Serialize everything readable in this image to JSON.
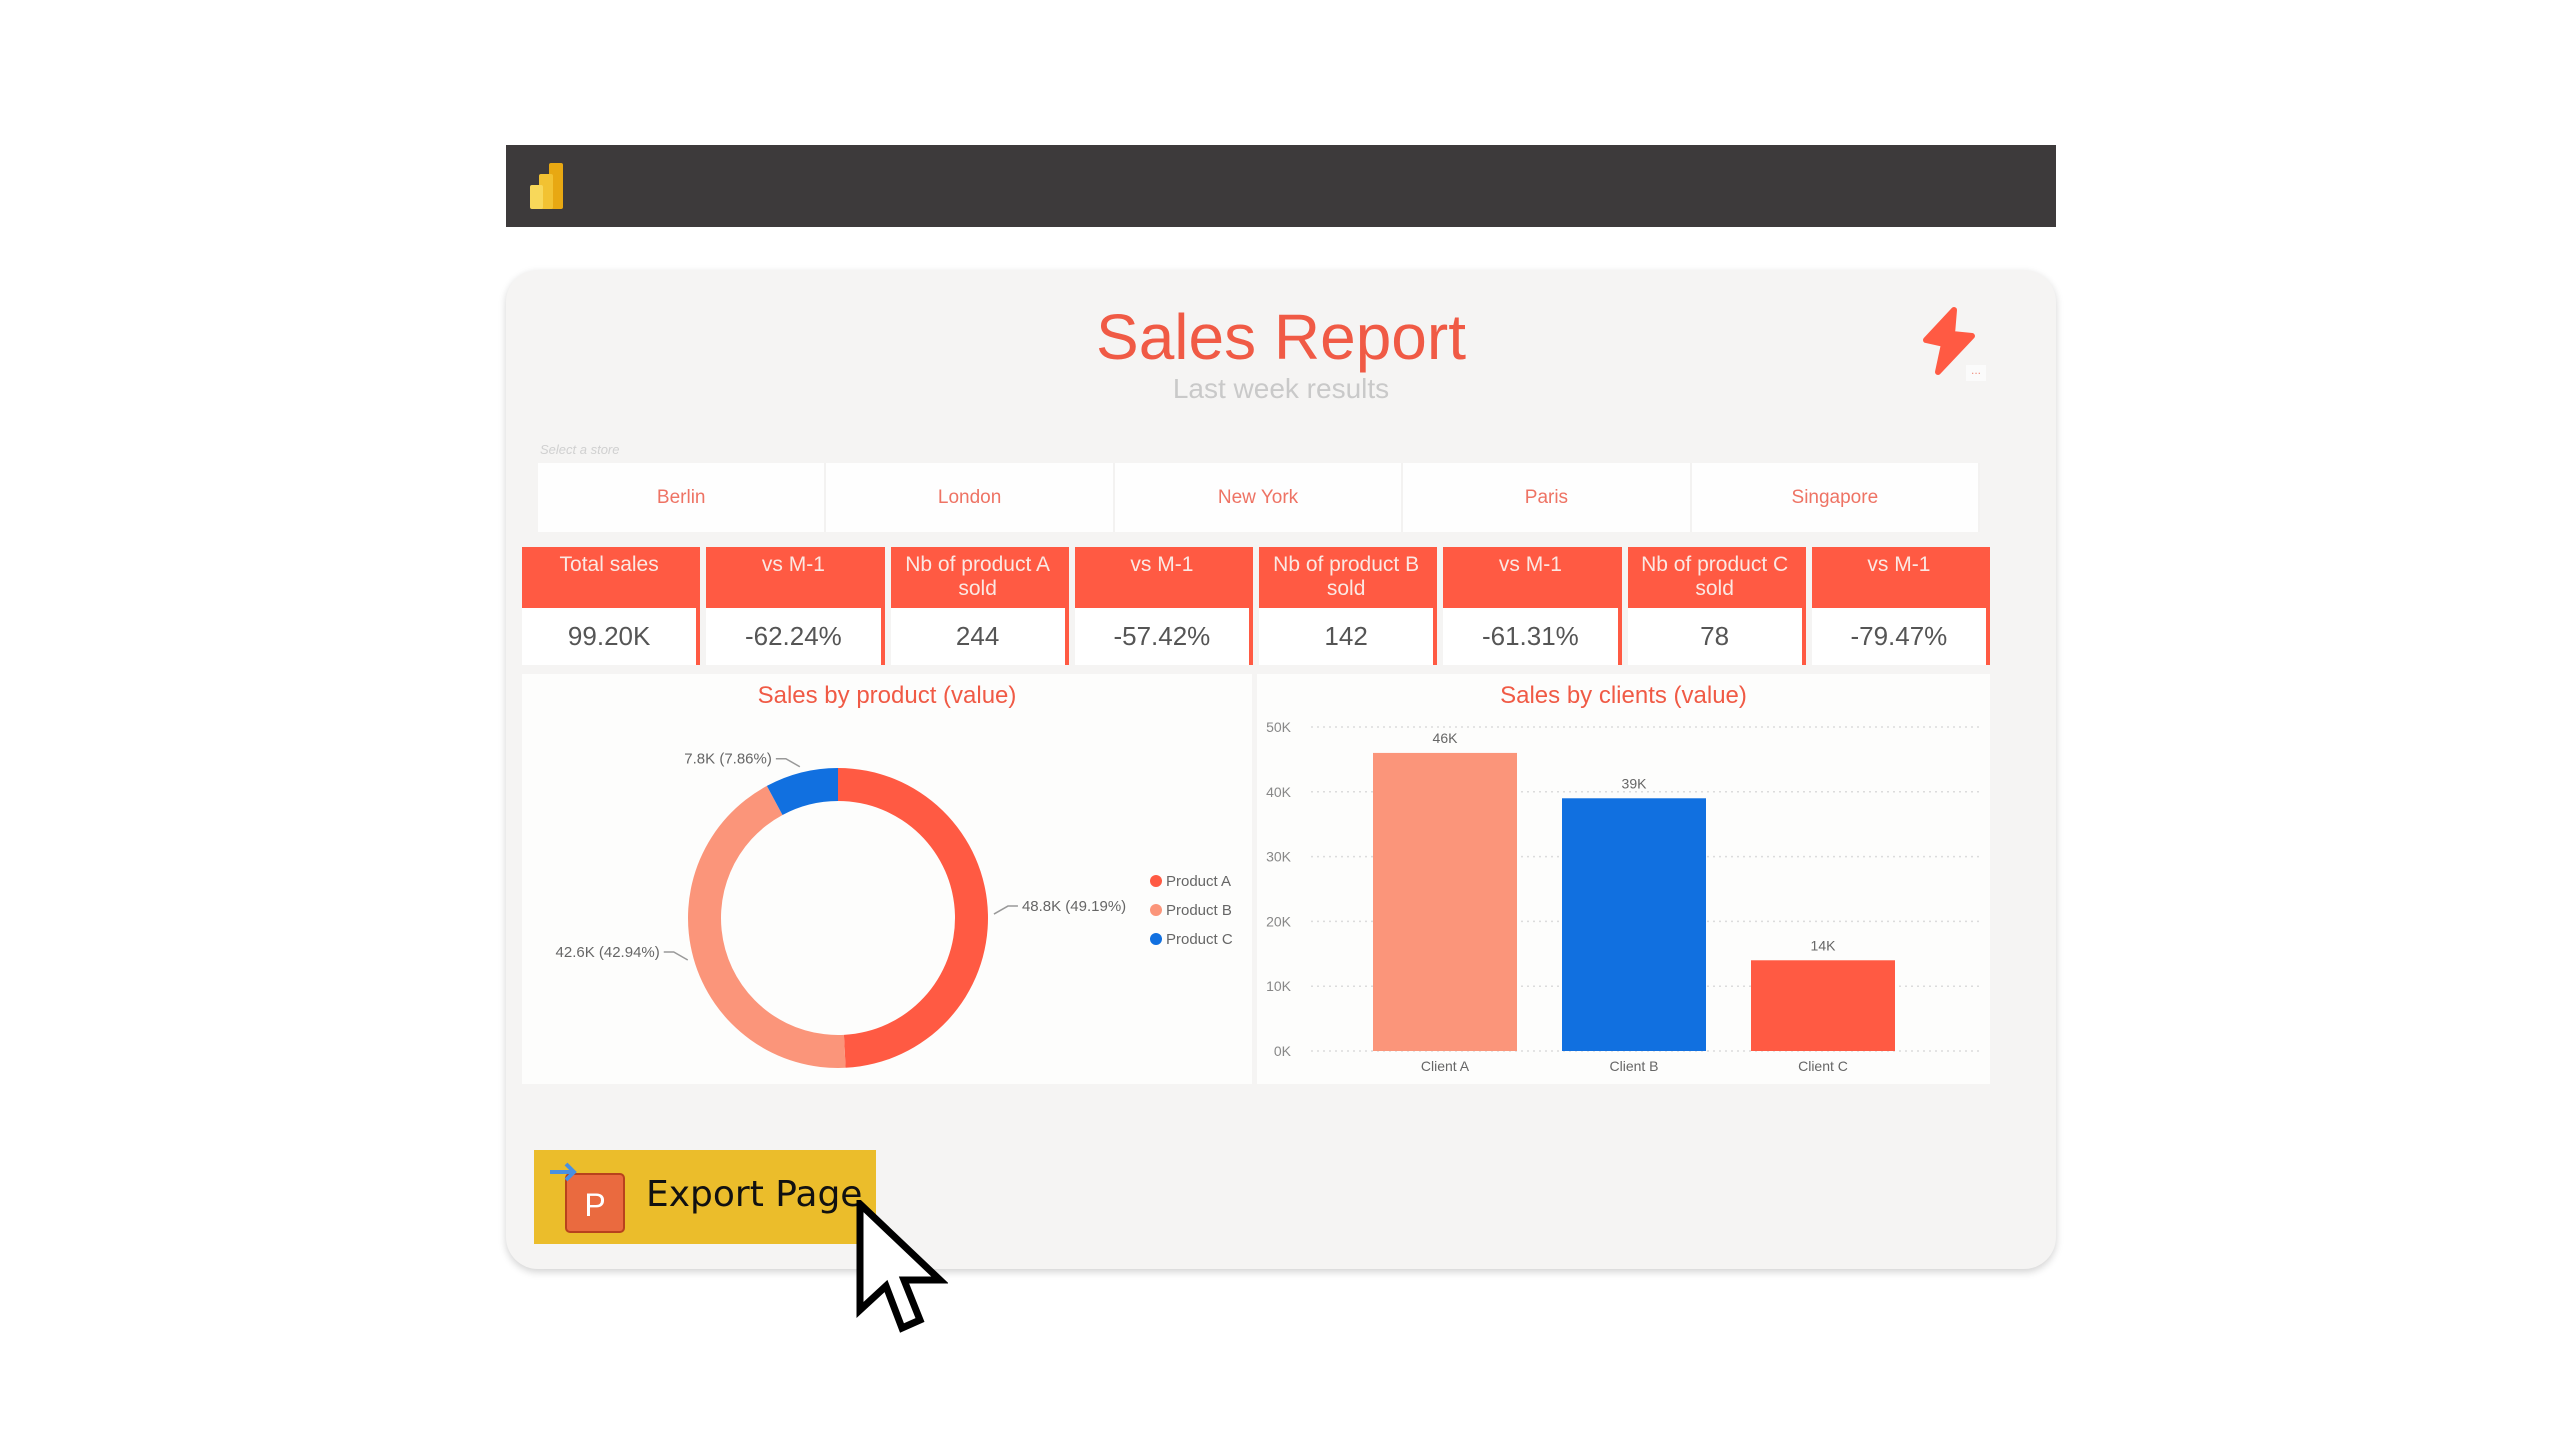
{
  "app": {
    "logo": "power-bi-logo-icon"
  },
  "report": {
    "title": "Sales Report",
    "subtitle": "Last week results",
    "bolt_icon": "lightning-bolt-icon",
    "more_label": "...",
    "slicer_label": "Select a store",
    "stores": [
      "Berlin",
      "London",
      "New York",
      "Paris",
      "Singapore"
    ]
  },
  "kpis": [
    {
      "header": "Total sales",
      "value": "99.20K"
    },
    {
      "header": "vs M-1",
      "value": "-62.24%"
    },
    {
      "header": "Nb of product A sold",
      "value": "244"
    },
    {
      "header": "vs M-1",
      "value": "-57.42%"
    },
    {
      "header": "Nb of product B sold",
      "value": "142"
    },
    {
      "header": "vs M-1",
      "value": "-61.31%"
    },
    {
      "header": "Nb of product C sold",
      "value": "78"
    },
    {
      "header": "vs M-1",
      "value": "-79.47%"
    }
  ],
  "colors": {
    "accent": "#ff5a43",
    "product_a": "#ff5a43",
    "product_b": "#fb957a",
    "product_c": "#1170e0",
    "export": "#ebbd2b"
  },
  "chart_data": [
    {
      "type": "pie",
      "title": "Sales by product (value)",
      "categories": [
        "Product A",
        "Product B",
        "Product C"
      ],
      "values": [
        48.8,
        42.6,
        7.8
      ],
      "unit": "K",
      "labels": [
        "48.8K (49.19%)",
        "42.6K (42.94%)",
        "7.8K (7.86%)"
      ],
      "colors": [
        "#ff5a43",
        "#fb957a",
        "#1170e0"
      ],
      "legend": "right",
      "donut": true
    },
    {
      "type": "bar",
      "title": "Sales by clients (value)",
      "categories": [
        "Client A",
        "Client B",
        "Client C"
      ],
      "values": [
        46,
        39,
        14
      ],
      "data_labels": [
        "46K",
        "39K",
        "14K"
      ],
      "colors": [
        "#fb957a",
        "#1170e0",
        "#ff5a43"
      ],
      "ylim": [
        0,
        50
      ],
      "yticks": [
        "0K",
        "10K",
        "20K",
        "30K",
        "40K",
        "50K"
      ],
      "grid": true,
      "xlabel": "",
      "ylabel": ""
    }
  ],
  "export": {
    "label": "Export Page",
    "icon": "powerpoint-icon",
    "icon_letter": "P"
  }
}
